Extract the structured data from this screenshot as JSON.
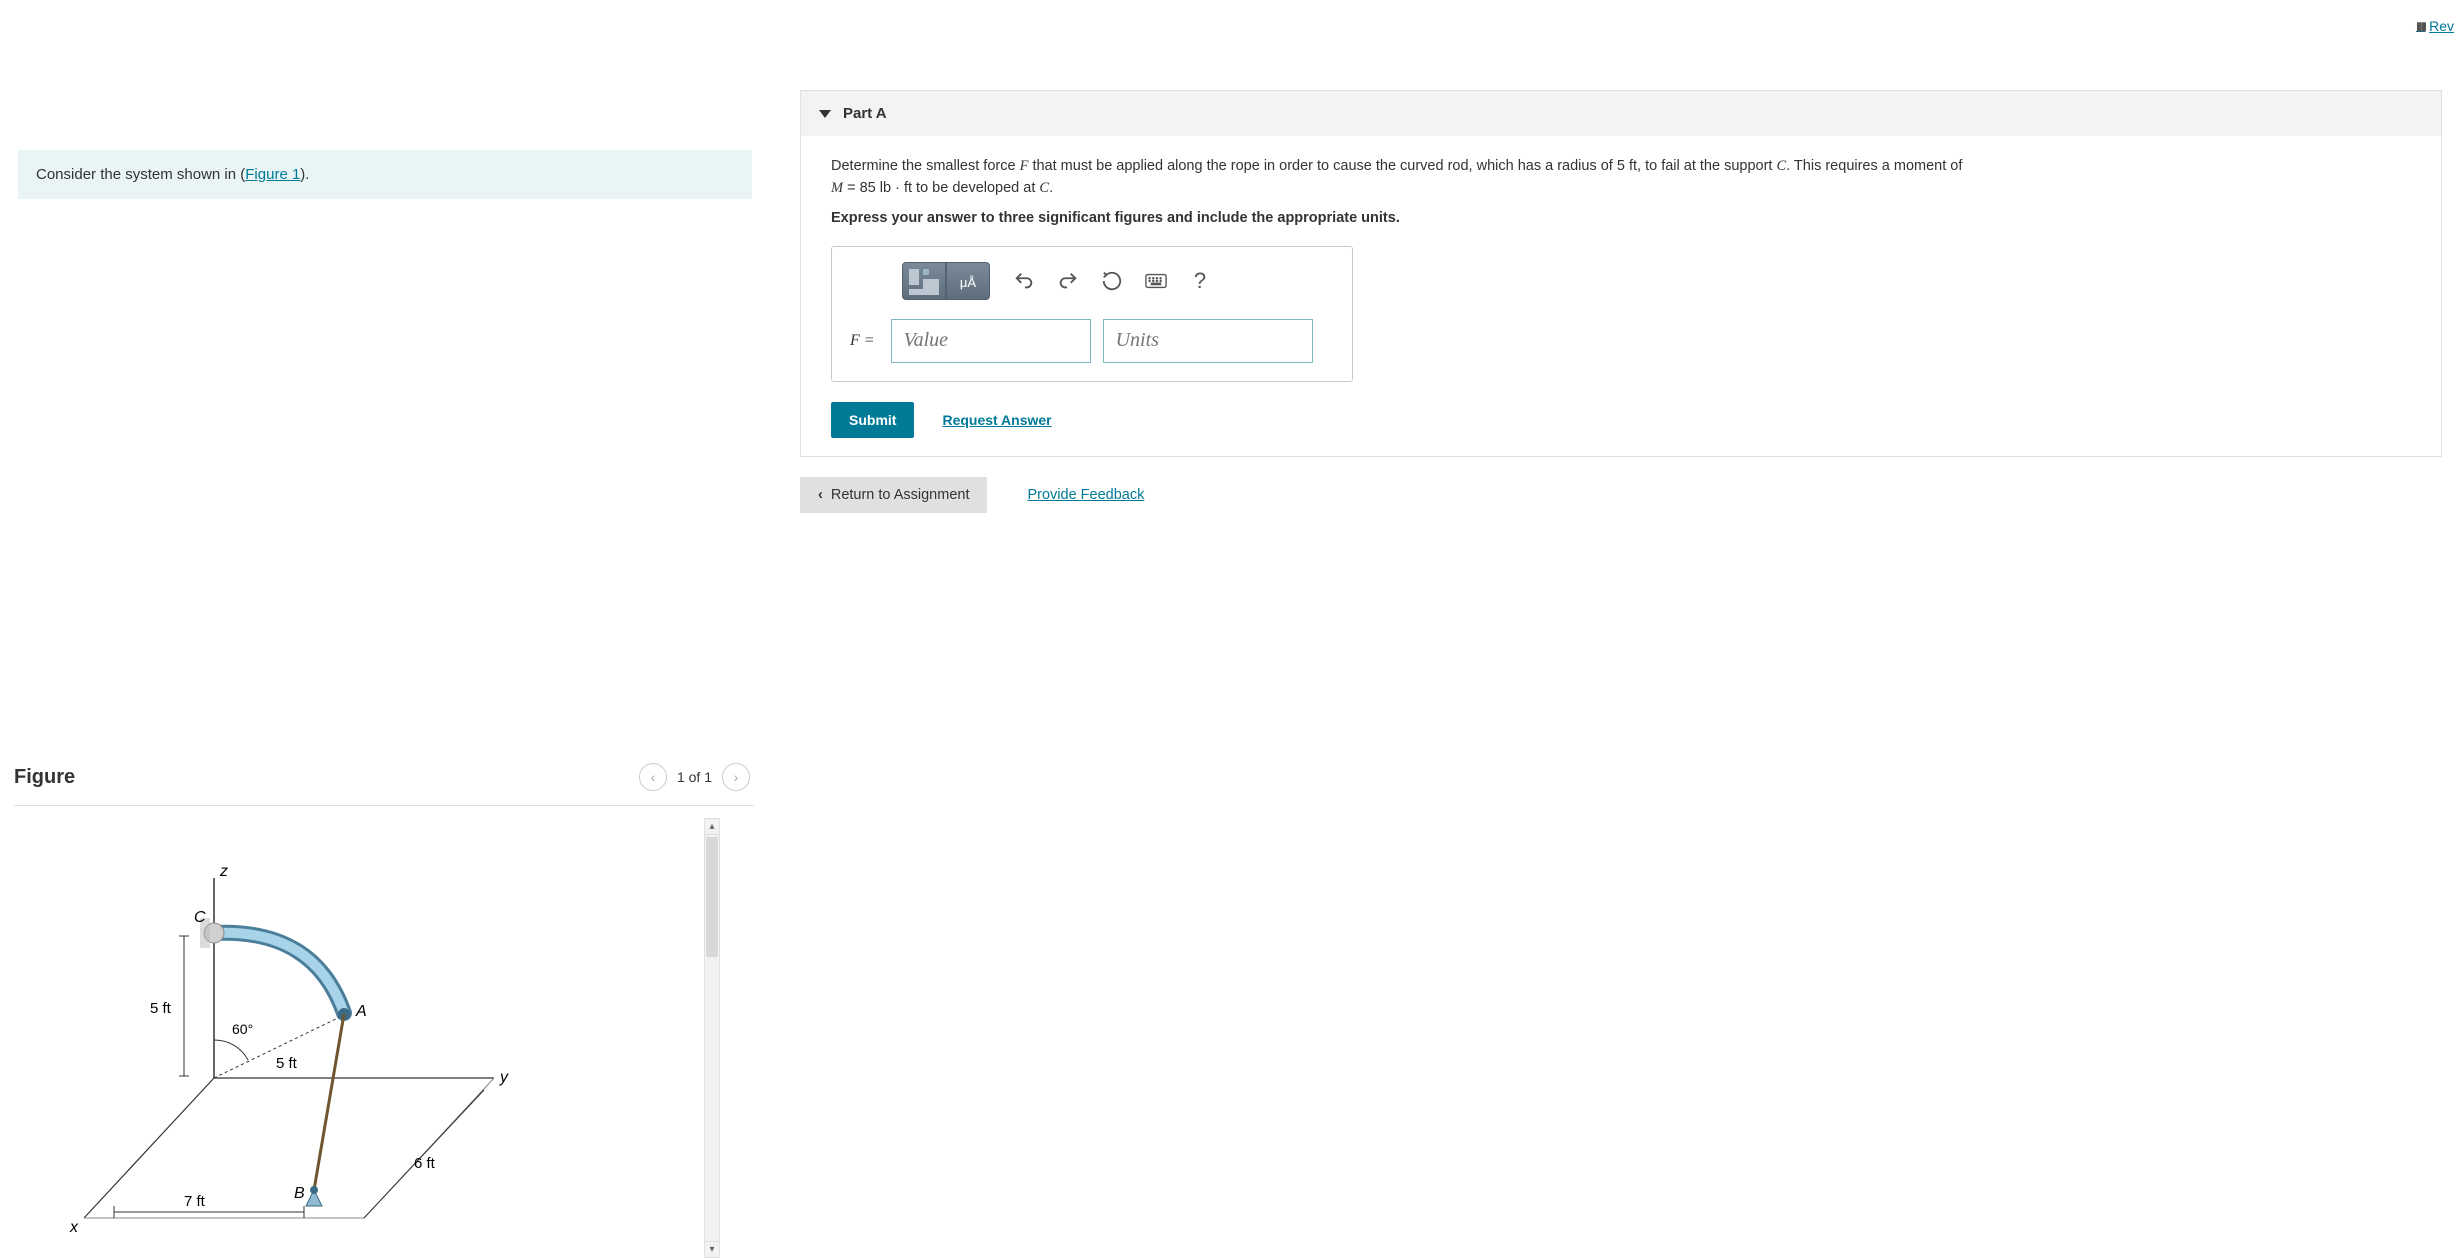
{
  "top_right": {
    "label": "Rev"
  },
  "info": {
    "prefix": "Consider the system shown in (",
    "link_text": "Figure 1",
    "suffix": ")."
  },
  "figure": {
    "title": "Figure",
    "nav": {
      "text": "1 of 1"
    },
    "labels": {
      "z": "z",
      "y": "y",
      "x": "x",
      "C": "C",
      "A": "A",
      "B": "B",
      "r5a": "5 ft",
      "r5b": "5 ft",
      "d6": "6 ft",
      "d7": "7 ft",
      "ang": "60°"
    }
  },
  "part": {
    "header": "Part A",
    "prompt": {
      "p1": "Determine the smallest force ",
      "Fvar": "F",
      "p2": " that must be applied along the rope in order to cause the curved rod, which has a radius of ",
      "r": "5 ft",
      "p3": ", to fail at the support ",
      "Cvar": "C",
      "p4": ". This requires a moment of ",
      "Mvar": "M",
      "Meq": " = 85 lb · ft",
      "p5": " to be developed at ",
      "p6": "."
    },
    "instr": "Express your answer to three significant figures and include the appropriate units.",
    "eq_label": "F =",
    "value_placeholder": "Value",
    "units_placeholder": "Units",
    "submit": "Submit",
    "request": "Request Answer",
    "special_btn": "μÅ"
  },
  "bottom": {
    "return": "Return to Assignment",
    "feedback": "Provide Feedback"
  }
}
